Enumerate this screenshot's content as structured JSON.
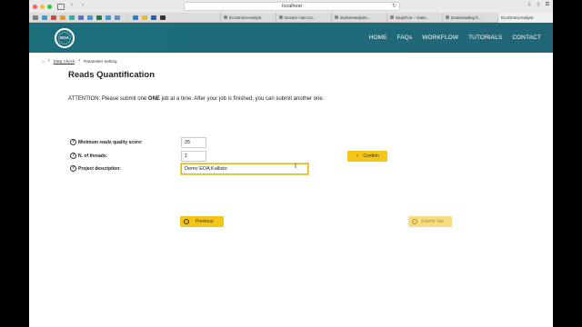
{
  "browser": {
    "url": "localhost",
    "tabs": [
      {
        "label": "EcoOmicsAnalyst",
        "active": false
      },
      {
        "label": "Docker Hub Co...",
        "active": false
      },
      {
        "label": "dockersealysts...",
        "active": false
      },
      {
        "label": "Seq2Fun – Data...",
        "active": false
      },
      {
        "label": "Downloading fr...",
        "active": false
      },
      {
        "label": "EcoOmicsAnalyst",
        "active": true
      }
    ]
  },
  "nav": {
    "items": [
      "HOME",
      "FAQs",
      "WORKFLOW",
      "TUTORIALS",
      "CONTACT"
    ]
  },
  "breadcrumb": {
    "step1": "Data Check",
    "step2": "Parameter Setting"
  },
  "page": {
    "title": "Reads Quantification",
    "attention_prefix": "ATTENTION: Please submit one ",
    "attention_bold": "ONE",
    "attention_suffix": " job at a time. After your job is finished, you can submit another one."
  },
  "form": {
    "min_quality_label": "Minimum reads quality score:",
    "min_quality_value": "25",
    "threads_label": "N. of threads:",
    "threads_value": "1",
    "project_label": "Project description:",
    "project_value": "Demo EOA Kallisto"
  },
  "buttons": {
    "confirm": "Confirm",
    "previous": "Previous",
    "submit": "Submit Job"
  },
  "colors": {
    "header": "#1d6f7c",
    "accent": "#f5c518"
  }
}
